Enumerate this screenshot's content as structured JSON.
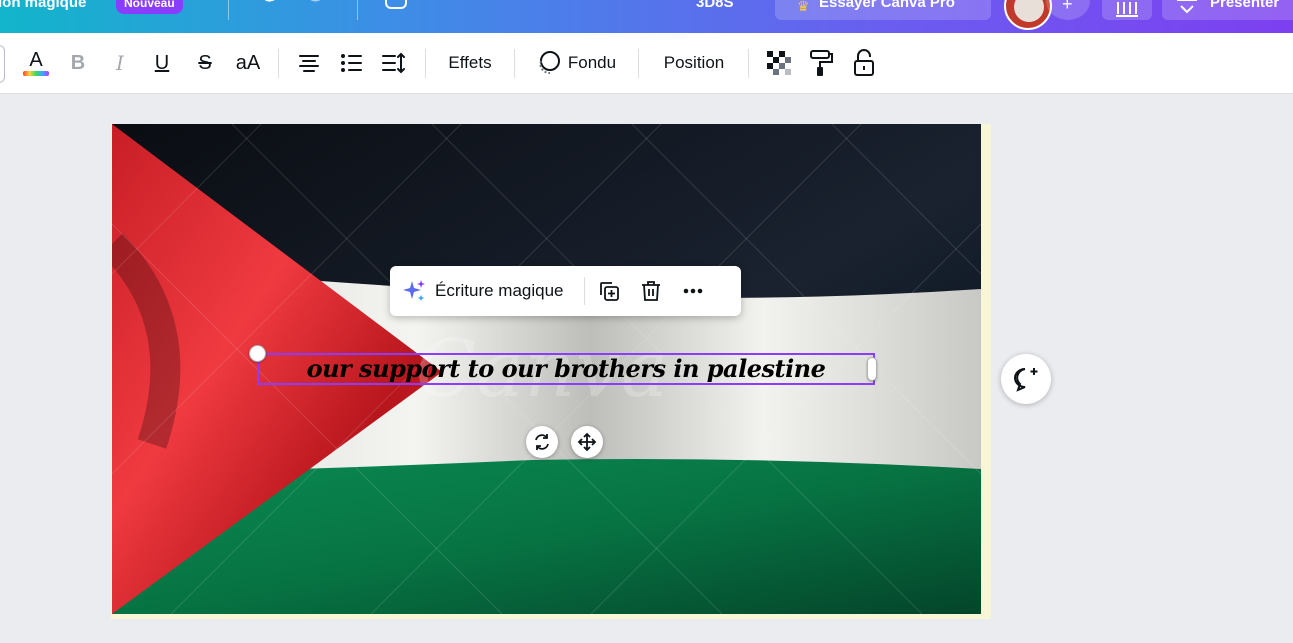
{
  "topbar": {
    "magic_label": "ion magique",
    "new_badge": "Nouveau",
    "size_label": "3D8S",
    "try_pro_label": "Essayer Canva Pro",
    "present_label": "Présenter"
  },
  "toolbar": {
    "effects_label": "Effets",
    "fade_label": "Fondu",
    "position_label": "Position",
    "font_size_glyph": "aA",
    "bold_glyph": "B",
    "italic_glyph": "I",
    "underline_glyph": "U",
    "strike_glyph": "S"
  },
  "float_menu": {
    "magic_write_label": "Écriture magique"
  },
  "canvas": {
    "text": "our support to our brothers in palestine",
    "watermark": "Canva"
  },
  "colors": {
    "accent": "#8b3dff",
    "flag_red": "#e8343b",
    "flag_black": "#0d1117",
    "flag_white": "#ededeb",
    "flag_green": "#0b7a48"
  }
}
